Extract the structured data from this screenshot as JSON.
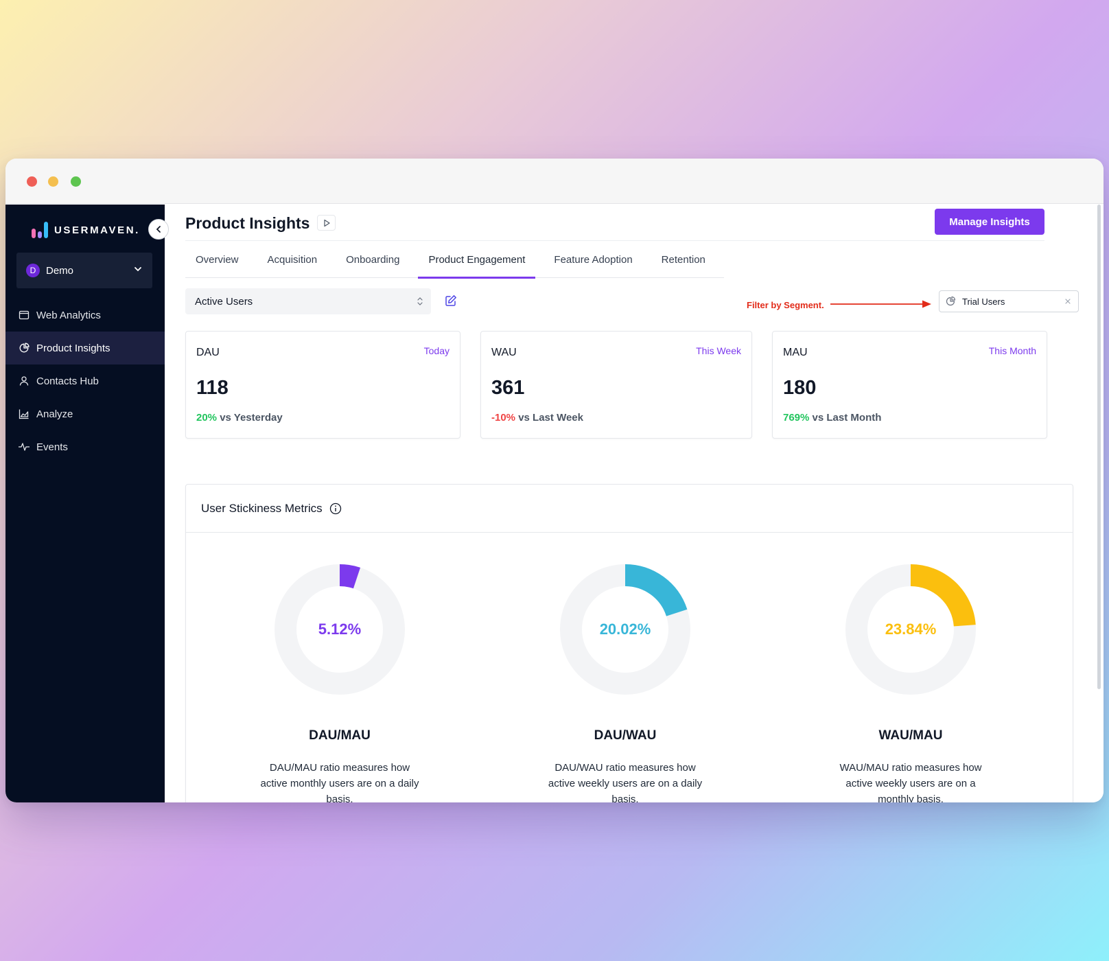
{
  "app": {
    "logo_text": "USERMAVEN.",
    "workspace": {
      "initial": "D",
      "name": "Demo"
    }
  },
  "sidebar": {
    "items": [
      {
        "label": "Web Analytics",
        "icon": "browser-window-icon",
        "active": false
      },
      {
        "label": "Product Insights",
        "icon": "pie-chart-icon",
        "active": true
      },
      {
        "label": "Contacts Hub",
        "icon": "user-icon",
        "active": false
      },
      {
        "label": "Analyze",
        "icon": "area-chart-icon",
        "active": false
      },
      {
        "label": "Events",
        "icon": "activity-pulse-icon",
        "active": false
      }
    ]
  },
  "header": {
    "title": "Product Insights",
    "manage_button": "Manage Insights"
  },
  "tabs": [
    {
      "label": "Overview",
      "active": false
    },
    {
      "label": "Acquisition",
      "active": false
    },
    {
      "label": "Onboarding",
      "active": false
    },
    {
      "label": "Product Engagement",
      "active": true
    },
    {
      "label": "Feature Adoption",
      "active": false
    },
    {
      "label": "Retention",
      "active": false
    }
  ],
  "toolbar": {
    "metric_select": "Active Users",
    "annotation": "Filter by Segment.",
    "segment": "Trial Users"
  },
  "kpis": [
    {
      "label": "DAU",
      "period": "Today",
      "value": "118",
      "change": "20%",
      "change_direction": "up",
      "compare": "vs Yesterday"
    },
    {
      "label": "WAU",
      "period": "This Week",
      "value": "361",
      "change": "-10%",
      "change_direction": "down",
      "compare": "vs Last Week"
    },
    {
      "label": "MAU",
      "period": "This Month",
      "value": "180",
      "change": "769%",
      "change_direction": "up",
      "compare": "vs Last Month"
    }
  ],
  "stickiness": {
    "title": "User Stickiness Metrics",
    "metrics": [
      {
        "title": "DAU/MAU",
        "percent": 5.12,
        "percent_label": "5.12%",
        "color": "#7c3aed",
        "description": "DAU/MAU ratio measures how active monthly users are on a daily basis."
      },
      {
        "title": "DAU/WAU",
        "percent": 20.02,
        "percent_label": "20.02%",
        "color": "#38b6d8",
        "description": "DAU/WAU ratio measures how active weekly users are on a daily basis."
      },
      {
        "title": "WAU/MAU",
        "percent": 23.84,
        "percent_label": "23.84%",
        "color": "#fbbf0e",
        "description": "WAU/MAU ratio measures how active weekly users are on a monthly basis."
      }
    ]
  },
  "colors": {
    "accent": "#7c3aed",
    "sidebar_bg": "#050e22",
    "positive": "#22c55e",
    "negative": "#ef4444",
    "annotation": "#e22c1a",
    "track": "#f3f4f6"
  }
}
